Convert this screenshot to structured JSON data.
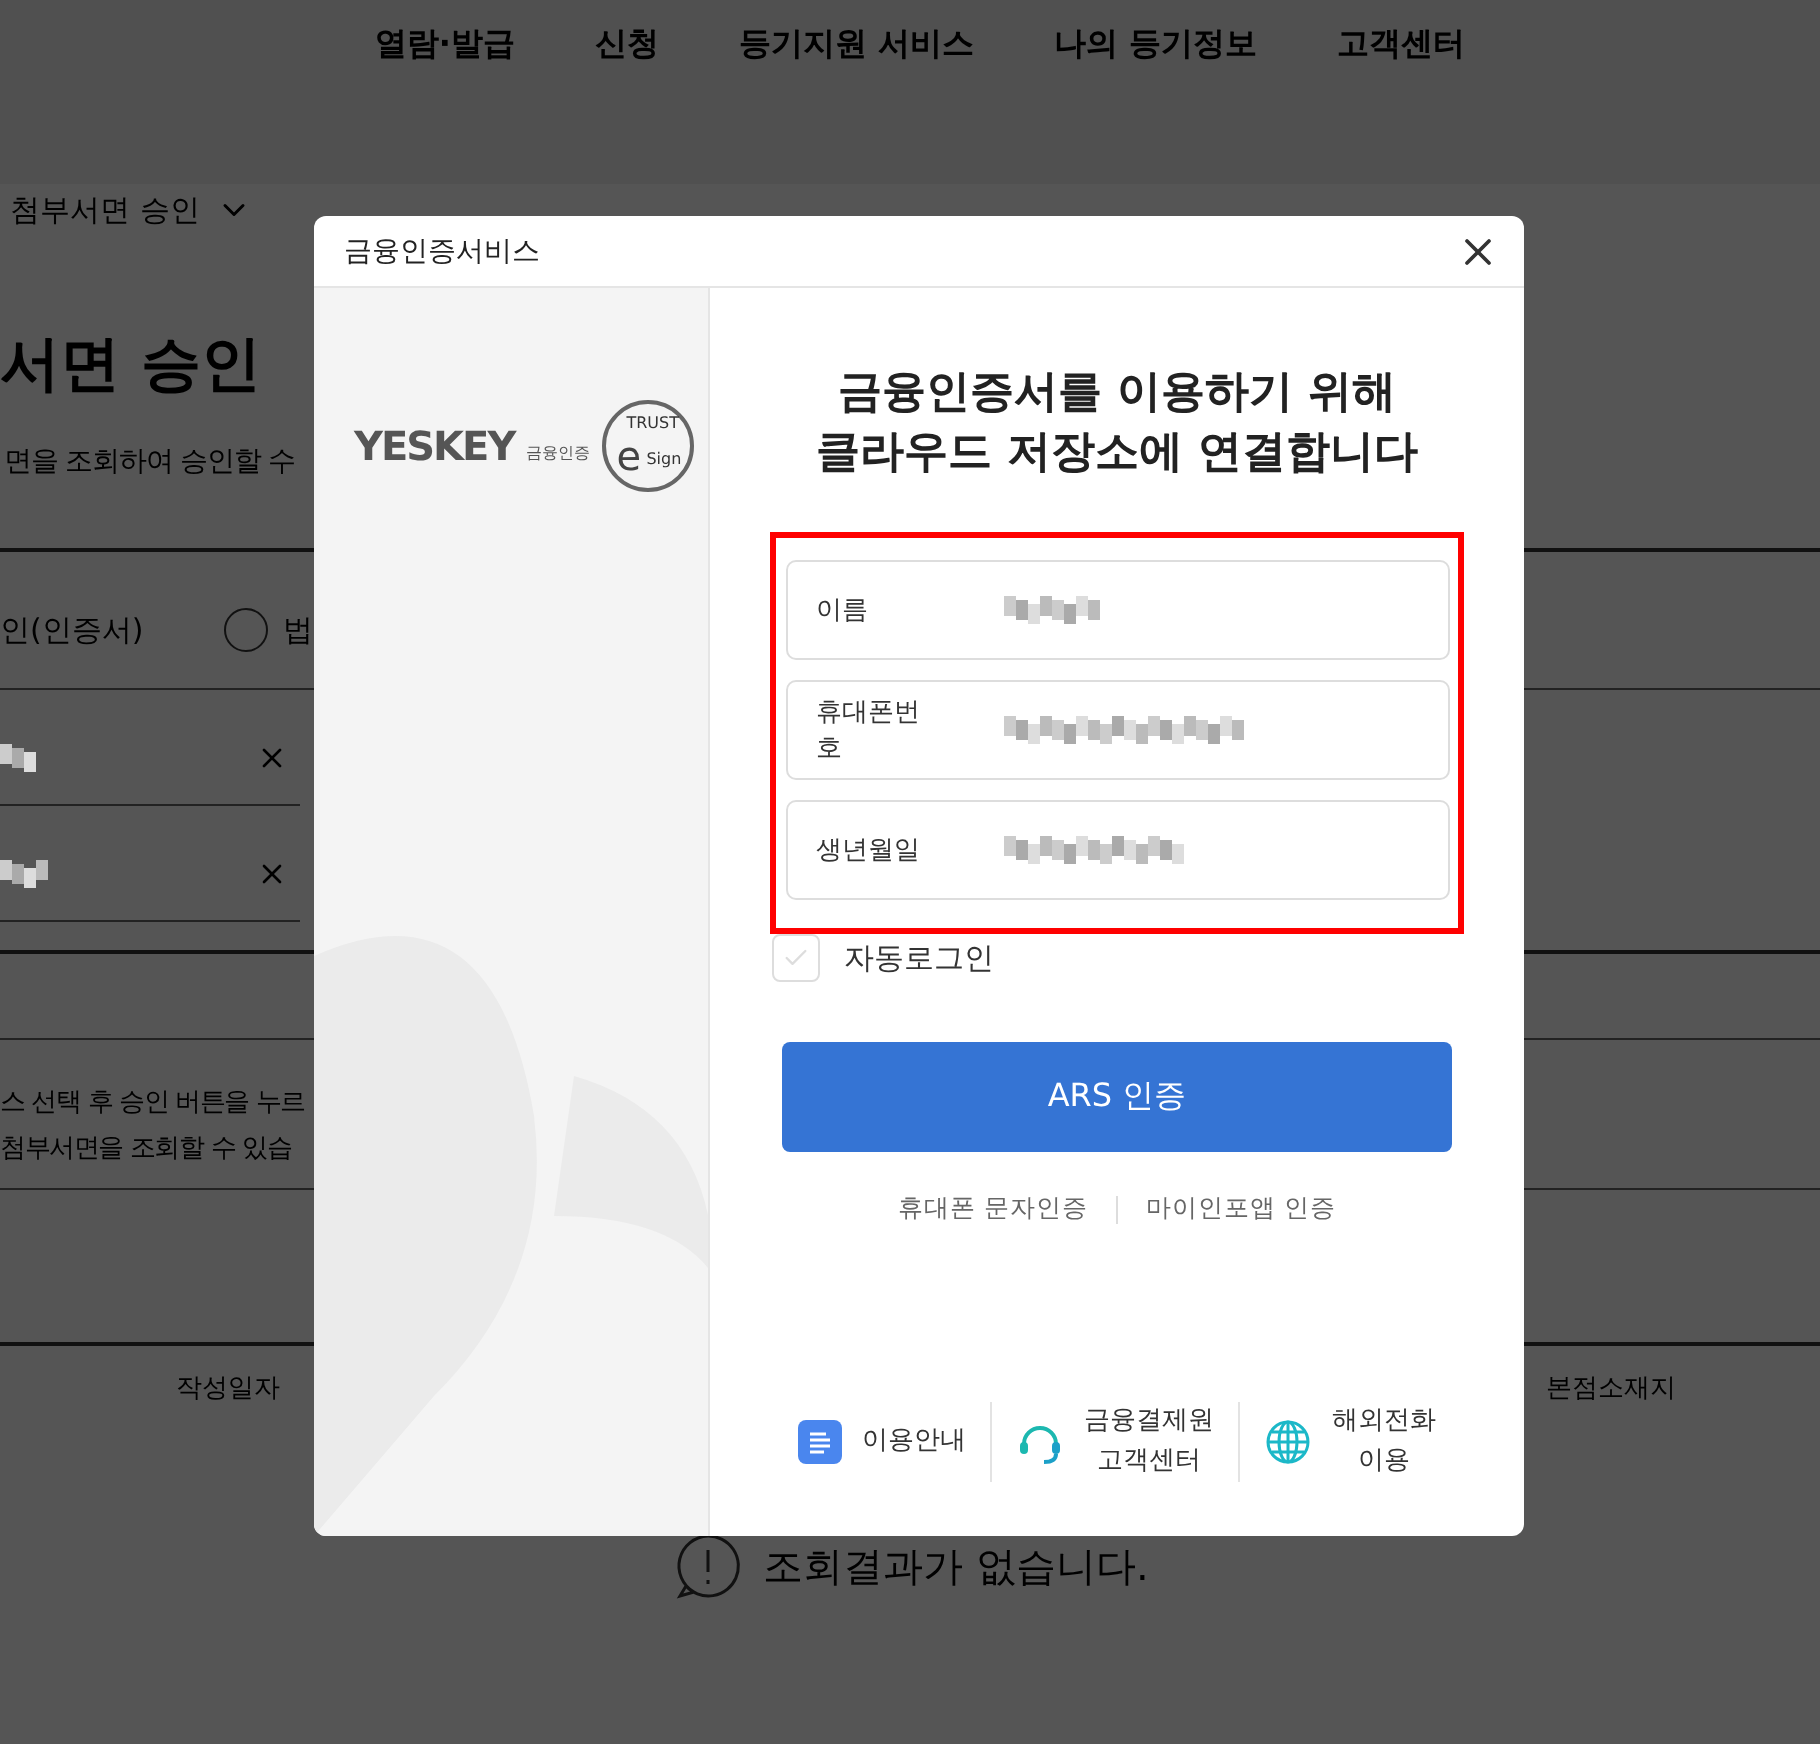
{
  "nav": {
    "items": [
      "열람·발급",
      "신청",
      "등기지원 서비스",
      "나의 등기정보",
      "고객센터"
    ]
  },
  "page": {
    "breadcrumb": "첨부서면 승인",
    "heading": "서면 승인",
    "description": "면을 조회하여 승인할 수",
    "radio_label_cut": "인(인증서)",
    "radio_option": {
      "label": "법",
      "selected": false
    },
    "instructions": [
      "스 선택 후 승인 버튼을 누르",
      "첨부서면을 조회할 수 있습"
    ],
    "table_columns": [
      "작성일자",
      "본점소재지"
    ],
    "empty_message": "조회결과가 없습니다."
  },
  "dialog": {
    "title": "금융인증서비스",
    "logo": {
      "brand": "YESKEY",
      "brand_sub": "금융인증",
      "seal_top": "TRUST",
      "seal_letter": "e",
      "seal_sub": "Sign"
    },
    "heading": [
      "금융인증서를 이용하기 위해",
      "클라우드 저장소에 연결합니다"
    ],
    "fields": [
      {
        "label": "이름"
      },
      {
        "label": "휴대폰번호"
      },
      {
        "label": "생년월일"
      }
    ],
    "auto_login": {
      "label": "자동로그인",
      "checked": false
    },
    "primary_button": "ARS 인증",
    "links": [
      "휴대폰 문자인증",
      "마이인포앱 인증"
    ],
    "footer": [
      {
        "kind": "guide",
        "lines": [
          "이용안내"
        ]
      },
      {
        "kind": "headset",
        "lines": [
          "금융결제원",
          "고객센터"
        ]
      },
      {
        "kind": "globe",
        "lines": [
          "해외전화",
          "이용"
        ]
      }
    ]
  }
}
